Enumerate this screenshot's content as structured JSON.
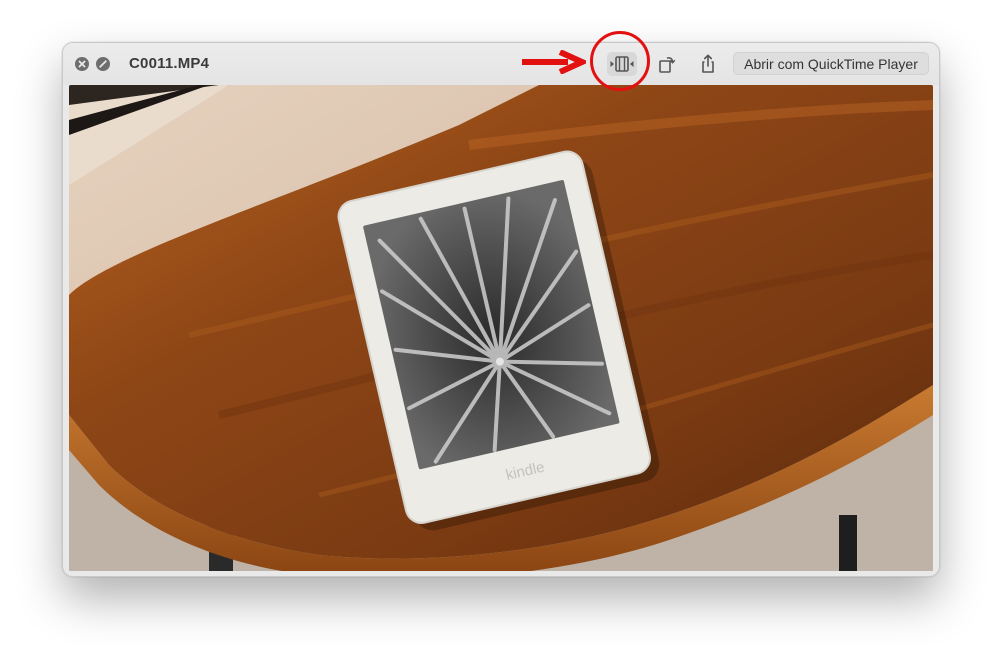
{
  "window": {
    "title": "C0011.MP4",
    "open_with_label": "Abrir com QuickTime Player"
  },
  "icons": {
    "close": "close-icon",
    "fullscreen": "fullscreen-icon",
    "trim": "trim-icon",
    "rotate": "rotate-icon",
    "share": "share-icon"
  },
  "video": {
    "device_brand": "kindle"
  },
  "colors": {
    "annotation": "#e31010",
    "titlebar": "#e9e9e9"
  }
}
